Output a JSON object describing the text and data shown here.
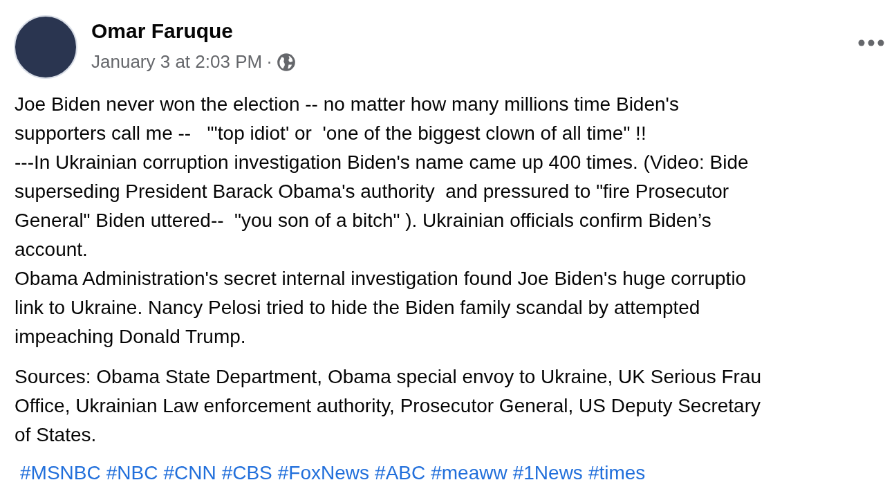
{
  "post": {
    "author": "Omar Faruque",
    "timestamp": "January 3 at 2:03 PM",
    "separator": "·",
    "paragraphs": [
      [
        "Joe Biden never won the election -- no matter how many millions time Biden's",
        "supporters call me --   \"'top idiot' or  'one of the biggest clown of all time\" !!",
        "---In Ukrainian corruption investigation Biden's name came up 400 times. (Video: Bide",
        "superseding President Barack Obama's authority  and pressured to \"fire Prosecutor",
        "General\" Biden uttered--  \"you son of a bitch\" ). Ukrainian officials confirm Biden’s",
        "account.",
        "Obama Administration's secret internal investigation found Joe Biden's huge corruptio",
        "link to Ukraine. Nancy Pelosi tried to hide the Biden family scandal by attempted",
        "impeaching Donald Trump."
      ],
      [
        "Sources: Obama State Department, Obama special envoy to Ukraine, UK Serious Frau",
        "Office, Ukrainian Law enforcement authority, Prosecutor General, US Deputy Secretary",
        "of States."
      ]
    ],
    "hashtags": [
      "#MSNBC",
      "#NBC",
      "#CNN",
      "#CBS",
      "#FoxNews",
      "#ABC",
      "#meaww",
      "#1News",
      "#times"
    ]
  }
}
